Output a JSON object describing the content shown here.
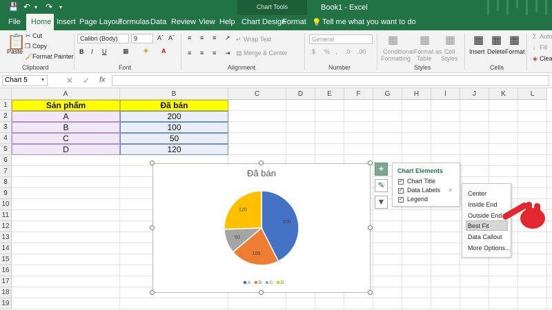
{
  "title_bar": {
    "doc_title": "Book1 - Excel",
    "context_label": "Chart Tools"
  },
  "tabs": [
    "File",
    "Home",
    "Insert",
    "Page Layout",
    "Formulas",
    "Data",
    "Review",
    "View",
    "Help",
    "Chart Design",
    "Format"
  ],
  "tell_me": "Tell me what you want to do",
  "ribbon": {
    "clipboard": {
      "paste": "Paste",
      "cut": "Cut",
      "copy": "Copy",
      "format_painter": "Format Painter",
      "label": "Clipboard"
    },
    "font": {
      "name": "Calibri (Body)",
      "size": "9",
      "label": "Font"
    },
    "alignment": {
      "wrap_text": "Wrap Text",
      "merge_center": "Merge & Center",
      "label": "Alignment"
    },
    "number": {
      "format": "General",
      "label": "Number"
    },
    "styles": {
      "conditional": "Conditional",
      "conditional2": "Formatting",
      "format_as": "Format as",
      "format_as2": "Table",
      "cell": "Cell",
      "cell2": "Styles",
      "label": "Styles"
    },
    "cells": {
      "insert": "Insert",
      "delete": "Delete",
      "format": "Format",
      "label": "Cells"
    },
    "editing": {
      "autosum": "Auto",
      "fill": "Fill",
      "clear": "Clea"
    }
  },
  "formula_bar": {
    "name_box": "Chart 5",
    "fx": "fx"
  },
  "columns": [
    "A",
    "B",
    "C",
    "D",
    "E",
    "F",
    "G",
    "H",
    "I",
    "J",
    "K",
    "L"
  ],
  "rows": [
    "1",
    "2",
    "3",
    "4",
    "5",
    "6",
    "7",
    "8",
    "9",
    "10",
    "11",
    "12",
    "13",
    "14",
    "15",
    "16",
    "17",
    "18",
    "19"
  ],
  "table": {
    "headers": [
      "Sản phẩm",
      "Đã bán"
    ],
    "rows": [
      [
        "A",
        "200"
      ],
      [
        "B",
        "100"
      ],
      [
        "C",
        "50"
      ],
      [
        "D",
        "120"
      ]
    ]
  },
  "chart_data": {
    "type": "pie",
    "title": "Đã bán",
    "categories": [
      "A",
      "B",
      "C",
      "D"
    ],
    "values": [
      200,
      100,
      50,
      120
    ],
    "colors": [
      "#4472C4",
      "#ED7D31",
      "#A5A5A5",
      "#FFC000"
    ],
    "legend_position": "bottom"
  },
  "chart_elements": {
    "title": "Chart Elements",
    "items": [
      {
        "label": "Chart Title",
        "checked": true
      },
      {
        "label": "Data Labels",
        "checked": true
      },
      {
        "label": "Legend",
        "checked": true
      }
    ]
  },
  "data_labels_menu": [
    "Center",
    "Inside End",
    "Outside End",
    "Best Fit",
    "Data Callout",
    "More Options..."
  ],
  "colors": {
    "excel_green": "#217346",
    "header_fill": "#FFFF00",
    "selection_fill": "#F0E8F5",
    "pointer_hand": "#E0282E"
  }
}
